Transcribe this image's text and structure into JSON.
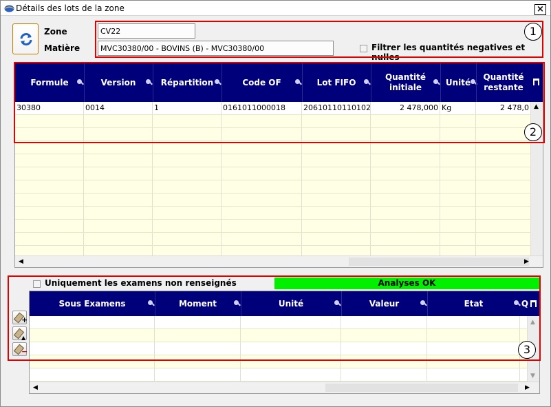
{
  "window": {
    "title": "Détails des lots de la zone",
    "close_label": "×"
  },
  "form": {
    "zone_label": "Zone",
    "zone_value": "CV22",
    "matiere_label": "Matière",
    "matiere_value": "MVC30380/00 - BOVINS (B) - MVC30380/00",
    "filter_label": "Filtrer les quantités negatives et nulles",
    "filter_checked": false
  },
  "lots_table": {
    "columns": [
      "Formule",
      "Version",
      "Répartition",
      "Code OF",
      "Lot FIFO",
      "Quantité initiale",
      "Unité",
      "Quantité restante"
    ],
    "rows": [
      [
        "30380",
        "0014",
        "1",
        "0161011000018",
        "20610110110102",
        "2 478,000",
        "Kg",
        "2 478,0"
      ]
    ],
    "empty_rows": 11
  },
  "exams": {
    "filter_label": "Uniquement les examens non renseignés",
    "filter_checked": false,
    "status_text": "Analyses OK",
    "status_color": "#00f000",
    "columns": [
      "Sous Examens",
      "Moment",
      "Unité",
      "Valeur",
      "Etat",
      "Q"
    ],
    "empty_rows": 5,
    "side_buttons": [
      "add-exam",
      "edit-exam",
      "delete-exam"
    ]
  },
  "annotations": [
    "1",
    "2",
    "3"
  ],
  "colors": {
    "header_bg": "#00007a",
    "row_alt": "#ffffe6",
    "annotation": "#e00000",
    "refresh_border": "#c97800"
  },
  "icons": {
    "app": "app-icon",
    "refresh": "refresh-icon",
    "sort": "sort-key-icon",
    "columns_menu": "column-chooser-icon"
  }
}
